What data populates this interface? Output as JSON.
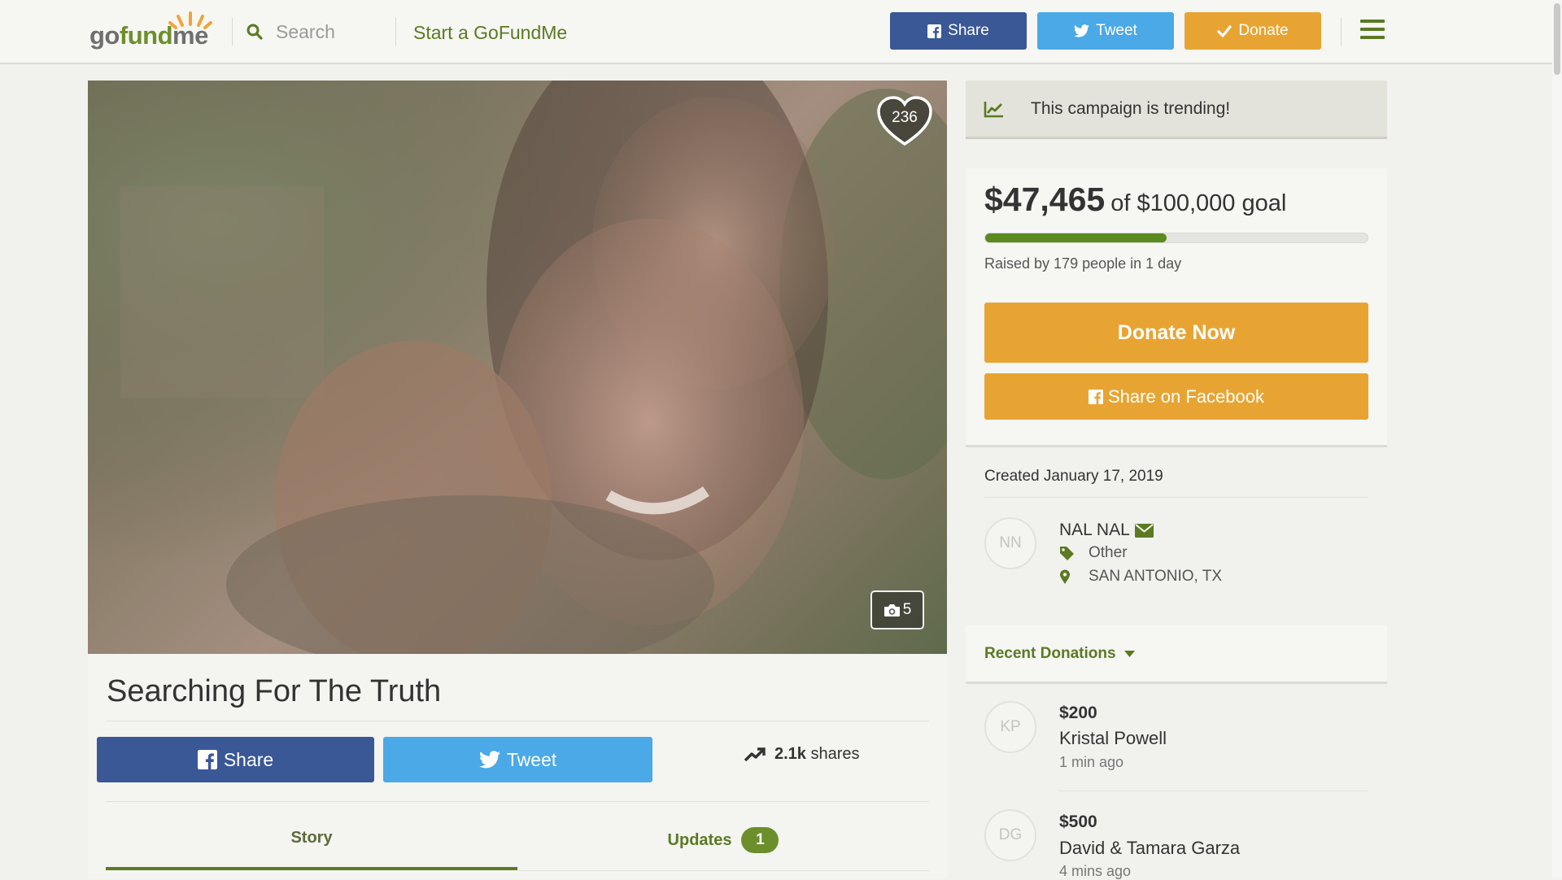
{
  "header": {
    "logo": {
      "part1": "go",
      "part2": "fund",
      "part3": "me"
    },
    "search_placeholder": "Search",
    "start_link": "Start a GoFundMe",
    "share_label": "Share",
    "tweet_label": "Tweet",
    "donate_label": "Donate"
  },
  "hero": {
    "heart_count": "236",
    "photo_count": "5"
  },
  "campaign": {
    "title": "Searching For The Truth",
    "share_label": "Share",
    "tweet_label": "Tweet",
    "shares_count": "2.1k",
    "shares_label": "shares",
    "tabs": [
      {
        "label": "Story"
      },
      {
        "label": "Updates",
        "count": "1"
      }
    ]
  },
  "sidebar": {
    "trending_text": "This campaign is trending!",
    "raised_amount": "$47,465",
    "goal_text": "of $100,000 goal",
    "progress_fraction": 0.47465,
    "raised_by": "Raised by 179 people in 1 day",
    "donate_now_label": "Donate Now",
    "share_facebook_label": "Share on Facebook",
    "created": "Created January 17, 2019",
    "organizer": {
      "initials": "NN",
      "name": "NAL NAL",
      "category": "Other",
      "location": "SAN ANTONIO, TX"
    },
    "recent_donations_label": "Recent Donations",
    "donations": [
      {
        "initials": "KP",
        "amount": "$200",
        "name": "Kristal Powell",
        "time": "1 min ago"
      },
      {
        "initials": "DG",
        "amount": "$500",
        "name": "David & Tamara Garza",
        "time": "4 mins ago"
      }
    ]
  },
  "colors": {
    "brand_green": "#5b7a22",
    "facebook_blue": "#3a5796",
    "twitter_blue": "#4aa9e6",
    "donate_orange": "#e8a433"
  }
}
